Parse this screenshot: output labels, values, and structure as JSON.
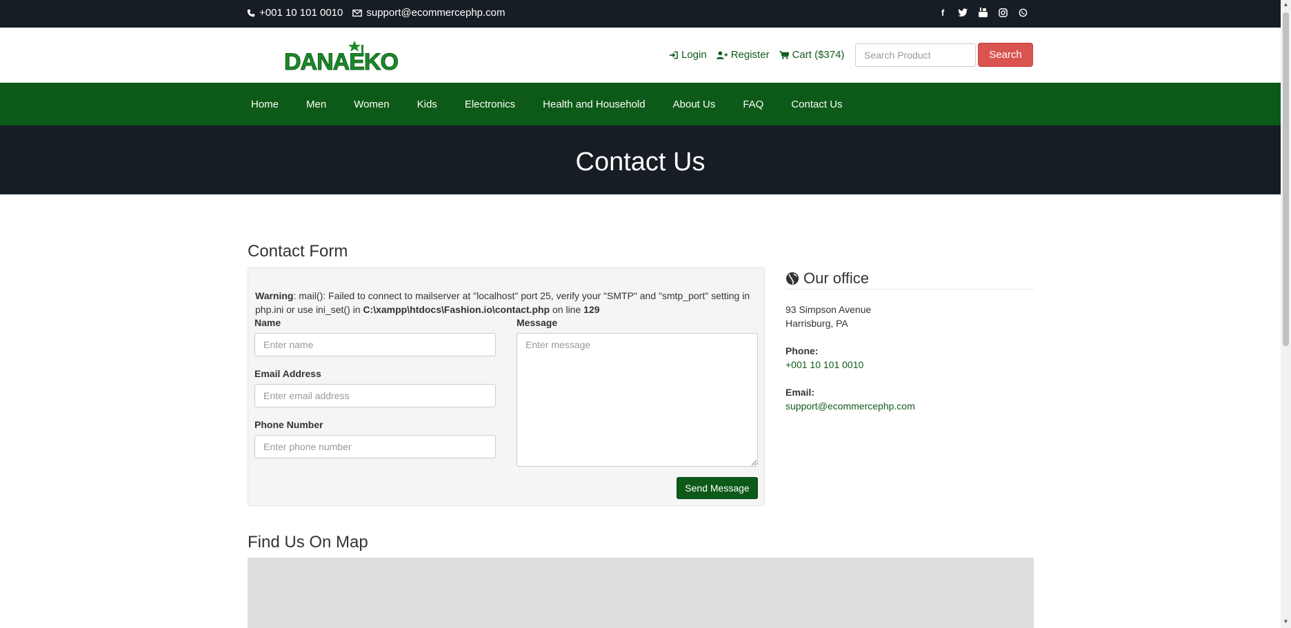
{
  "topbar": {
    "phone": "+001 10 101 0010",
    "email": "support@ecommercephp.com",
    "social_icons": [
      "facebook-icon",
      "twitter-icon",
      "youtube-icon",
      "instagram-icon",
      "whatsapp-icon"
    ],
    "background": "#171d24"
  },
  "header": {
    "logo_text": "DANAEKO",
    "login_label": "Login",
    "register_label": "Register",
    "cart_label": "Cart ($374)",
    "search_placeholder": "Search Product",
    "search_button": "Search"
  },
  "nav": {
    "items": [
      "Home",
      "Men",
      "Women",
      "Kids",
      "Electronics",
      "Health and Household",
      "About Us",
      "FAQ",
      "Contact Us"
    ],
    "background": "#0d5a18"
  },
  "banner": {
    "title": "Contact Us"
  },
  "contact_form": {
    "title": "Contact Form",
    "warning_label": "Warning",
    "warning_text": ": mail(): Failed to connect to mailserver at \"localhost\" port 25, verify your \"SMTP\" and \"smtp_port\" setting in php.ini or use ini_set() in ",
    "warning_path": "C:\\xampp\\htdocs\\Fashion.io\\contact.php",
    "warning_on_line": " on line ",
    "warning_line": "129",
    "name_label": "Name",
    "name_placeholder": "Enter name",
    "email_label": "Email Address",
    "email_placeholder": "Enter email address",
    "phone_label": "Phone Number",
    "phone_placeholder": "Enter phone number",
    "message_label": "Message",
    "message_placeholder": "Enter message",
    "send_button": "Send Message"
  },
  "office": {
    "title": "Our office",
    "address_line1": "93 Simpson Avenue",
    "address_line2": "Harrisburg, PA",
    "phone_label": "Phone:",
    "phone": "+001 10 101 0010",
    "email_label": "Email:",
    "email": "support@ecommercephp.com"
  },
  "map": {
    "title": "Find Us On Map"
  },
  "colors": {
    "accent_green": "#0d5a18",
    "search_red": "#d9534f",
    "dark": "#171d24"
  }
}
